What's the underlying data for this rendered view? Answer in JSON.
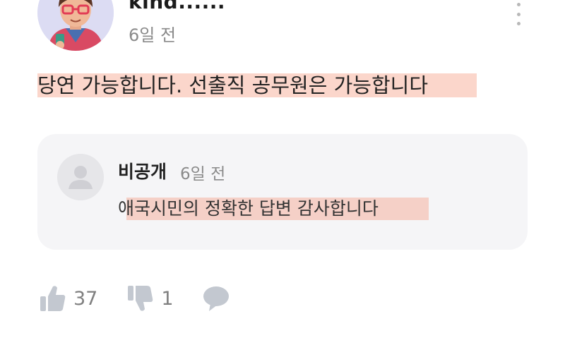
{
  "comment": {
    "author": "kind......",
    "timestamp": "6일 전",
    "text": "당연 가능합니다. 선출직 공무원은 가능합니다",
    "highlight_color": "#f7a58c"
  },
  "reply": {
    "author": "비공개",
    "timestamp": "6일 전",
    "text": "애국시민의 정확한 답변 감사합니다",
    "background_color": "#f5f5f7"
  },
  "actions": {
    "like_icon": "thumbs-up-icon",
    "like_count": "37",
    "dislike_icon": "thumbs-down-icon",
    "dislike_count": "1",
    "reply_icon": "speech-bubble-icon",
    "icon_color": "#c3c8d0"
  },
  "menu_icon": "more-vertical-icon"
}
